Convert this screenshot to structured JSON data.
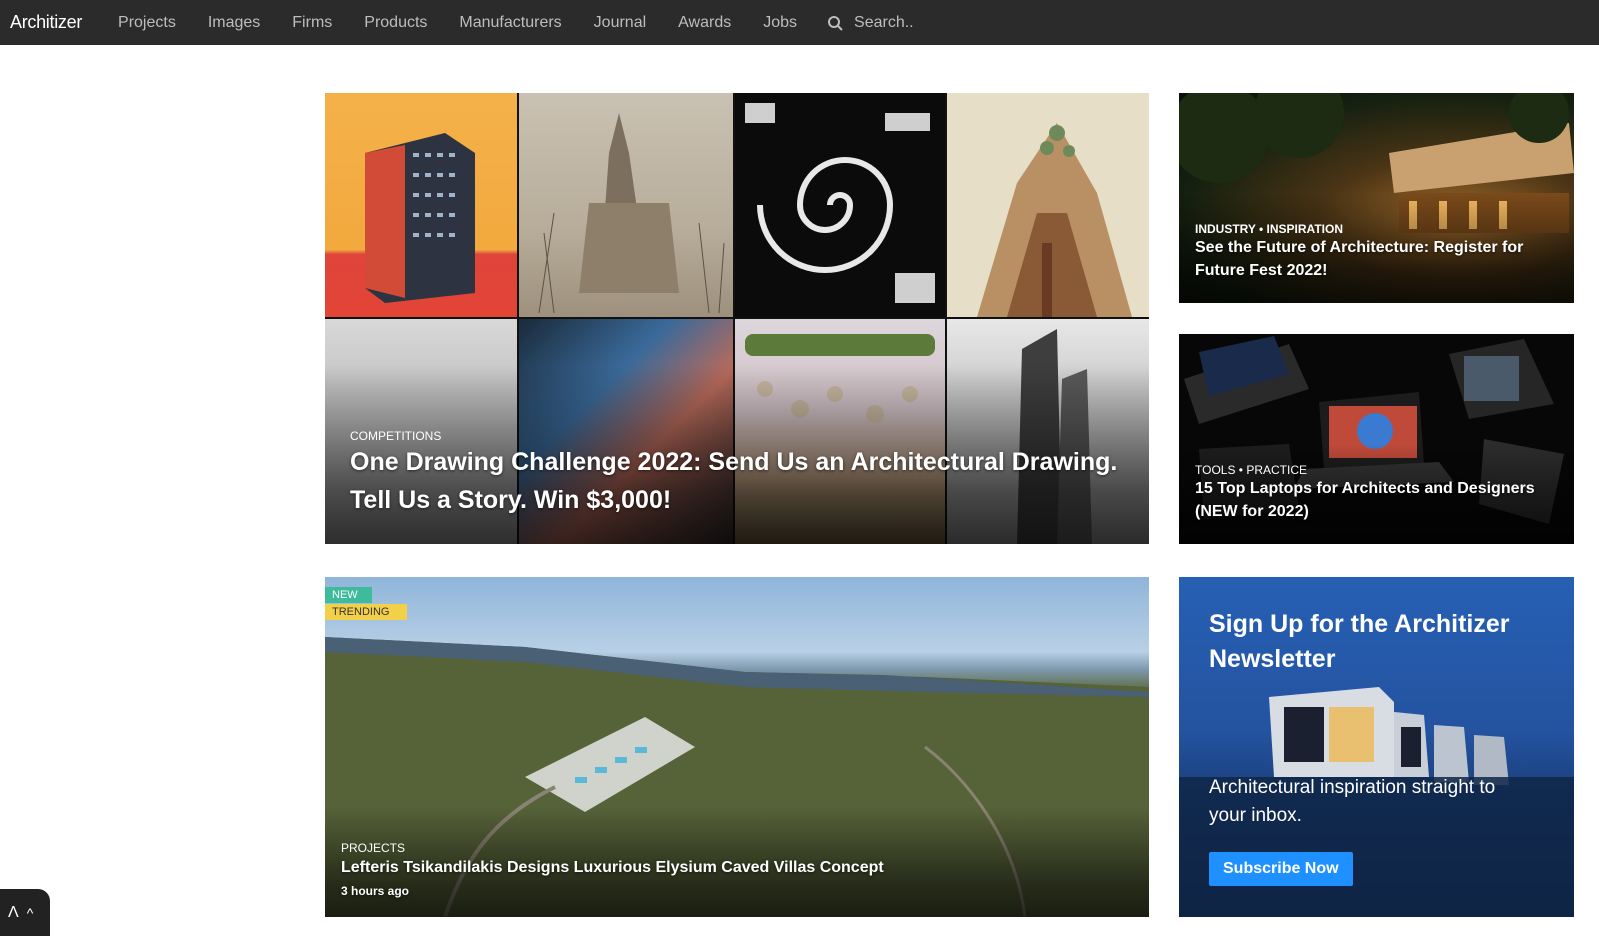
{
  "nav": {
    "logo": "Architizer",
    "items": [
      "Projects",
      "Images",
      "Firms",
      "Products",
      "Manufacturers",
      "Journal",
      "Awards",
      "Jobs"
    ],
    "search_placeholder": "Search.."
  },
  "feature": {
    "category": "COMPETITIONS",
    "title_line1": "One Drawing Challenge 2022: Send Us an Architectural Drawing.",
    "title_line2": "Tell Us a Story. Win $3,000!"
  },
  "side_cards": [
    {
      "category": "INDUSTRY • INSPIRATION",
      "title_line1": "See the Future of Architecture: Register for",
      "title_line2": "Future Fest 2022!"
    },
    {
      "category": "TOOLS • PRACTICE",
      "title_line1": "15 Top Laptops for Architects and Designers",
      "title_line2": "(NEW for 2022)"
    }
  ],
  "hero": {
    "badge_new": "NEW",
    "badge_trending": "TRENDING",
    "category": "PROJECTS",
    "title": "Lefteris Tsikandilakis Designs Luxurious Elysium Caved Villas Concept",
    "time": "3 hours ago"
  },
  "newsletter": {
    "title_line1": "Sign Up for the Architizer",
    "title_line2": "Newsletter",
    "text_line1": "Architectural inspiration straight to",
    "text_line2": "your inbox.",
    "button": "Subscribe Now"
  },
  "bottom_tab": {
    "glyph": "Λ",
    "chevron": "^"
  },
  "colors": {
    "nav_bg": "#2b2b2b",
    "badge_new": "#3dbb9b",
    "badge_trending": "#f3d04a",
    "subscribe": "#1e90ff"
  }
}
